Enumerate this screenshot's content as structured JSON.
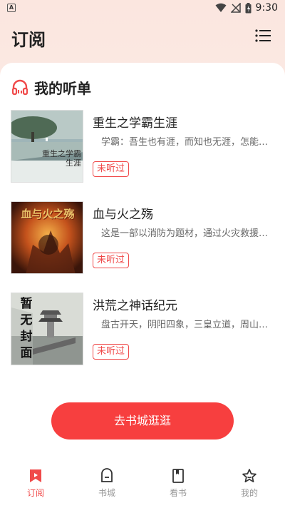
{
  "status_bar": {
    "time": "9:30",
    "app_icon_letter": "A"
  },
  "header": {
    "title": "订阅",
    "menu_icon": "list-menu-icon"
  },
  "section": {
    "title": "我的听单",
    "icon": "headphones-icon",
    "accent_color": "#f04a4a"
  },
  "books": [
    {
      "name": "重生之学霸生涯",
      "desc": "学霸：吾生也有涯，而知也无涯，怎能不…",
      "badge": "未听过",
      "cover_text": "重生之学霸生涯"
    },
    {
      "name": "血与火之殇",
      "desc": "这是一部以消防为题材，通过火灾救援、…",
      "badge": "未听过",
      "cover_text": "血与火之殇"
    },
    {
      "name": "洪荒之神话纪元",
      "desc": "盘古开天，阴阳四象，三皇立道，周山永…",
      "badge": "未听过",
      "cover_text": "暂无封面"
    }
  ],
  "cta": {
    "label": "去书城逛逛",
    "color": "#f73f3f"
  },
  "tabbar": {
    "items": [
      {
        "label": "订阅",
        "icon": "bookmark-icon",
        "active": true
      },
      {
        "label": "书城",
        "icon": "shop-icon",
        "active": false
      },
      {
        "label": "看书",
        "icon": "book-icon",
        "active": false
      },
      {
        "label": "我的",
        "icon": "star-icon",
        "active": false
      }
    ]
  }
}
